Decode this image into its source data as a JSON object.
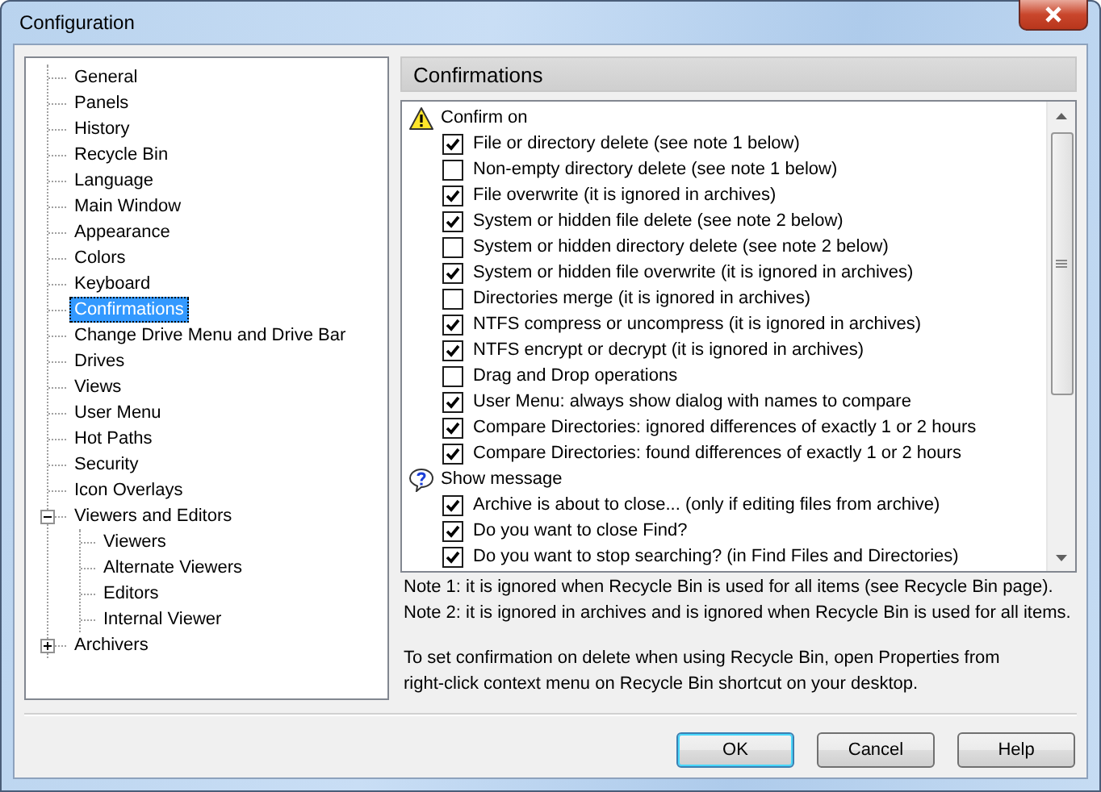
{
  "window": {
    "title": "Configuration"
  },
  "tree": {
    "items": [
      {
        "label": "General",
        "selected": false
      },
      {
        "label": "Panels",
        "selected": false
      },
      {
        "label": "History",
        "selected": false
      },
      {
        "label": "Recycle Bin",
        "selected": false
      },
      {
        "label": "Language",
        "selected": false
      },
      {
        "label": "Main Window",
        "selected": false
      },
      {
        "label": "Appearance",
        "selected": false
      },
      {
        "label": "Colors",
        "selected": false
      },
      {
        "label": "Keyboard",
        "selected": false
      },
      {
        "label": "Confirmations",
        "selected": true
      },
      {
        "label": "Change Drive Menu and Drive Bar",
        "selected": false
      },
      {
        "label": "Drives",
        "selected": false
      },
      {
        "label": "Views",
        "selected": false
      },
      {
        "label": "User Menu",
        "selected": false
      },
      {
        "label": "Hot Paths",
        "selected": false
      },
      {
        "label": "Security",
        "selected": false
      },
      {
        "label": "Icon Overlays",
        "selected": false
      },
      {
        "label": "Viewers and Editors",
        "selected": false,
        "expanded": true,
        "children": [
          {
            "label": "Viewers",
            "selected": false
          },
          {
            "label": "Alternate Viewers",
            "selected": false
          },
          {
            "label": "Editors",
            "selected": false
          },
          {
            "label": "Internal Viewer",
            "selected": false
          }
        ]
      },
      {
        "label": "Archivers",
        "selected": false,
        "expanded": false
      }
    ]
  },
  "panel": {
    "title": "Confirmations",
    "groups": [
      {
        "kind": "warning",
        "label": "Confirm on",
        "items": [
          {
            "label": "File or directory delete (see note 1 below)",
            "checked": true
          },
          {
            "label": "Non-empty directory delete (see note 1 below)",
            "checked": false
          },
          {
            "label": "File overwrite (it is ignored in archives)",
            "checked": true
          },
          {
            "label": "System or hidden file delete (see note 2 below)",
            "checked": true
          },
          {
            "label": "System or hidden directory delete (see note 2 below)",
            "checked": false
          },
          {
            "label": "System or hidden file overwrite (it is ignored in archives)",
            "checked": true
          },
          {
            "label": "Directories merge (it is ignored in archives)",
            "checked": false
          },
          {
            "label": "NTFS compress or uncompress (it is ignored in archives)",
            "checked": true
          },
          {
            "label": "NTFS encrypt or decrypt (it is ignored in archives)",
            "checked": true
          },
          {
            "label": "Drag and Drop operations",
            "checked": false
          },
          {
            "label": "User Menu: always show dialog with names to compare",
            "checked": true
          },
          {
            "label": "Compare Directories: ignored differences of exactly 1 or 2 hours",
            "checked": true
          },
          {
            "label": "Compare Directories: found differences of exactly 1 or 2 hours",
            "checked": true
          }
        ]
      },
      {
        "kind": "question",
        "label": "Show message",
        "items": [
          {
            "label": "Archive is about to close... (only if editing files from archive)",
            "checked": true
          },
          {
            "label": "Do you want to close Find?",
            "checked": true
          },
          {
            "label": "Do you want to stop searching? (in Find Files and Directories)",
            "checked": true
          }
        ]
      }
    ],
    "notes": [
      "Note 1: it is ignored when Recycle Bin is used for all items (see Recycle Bin page).",
      "Note 2: it is ignored in archives and is ignored when Recycle Bin is used for all items."
    ],
    "hint": "To set confirmation on delete when using Recycle Bin, open Properties from right-click context menu on Recycle Bin shortcut on your desktop."
  },
  "buttons": [
    {
      "label": "OK",
      "default": true
    },
    {
      "label": "Cancel",
      "default": false
    },
    {
      "label": "Help",
      "default": false
    }
  ]
}
